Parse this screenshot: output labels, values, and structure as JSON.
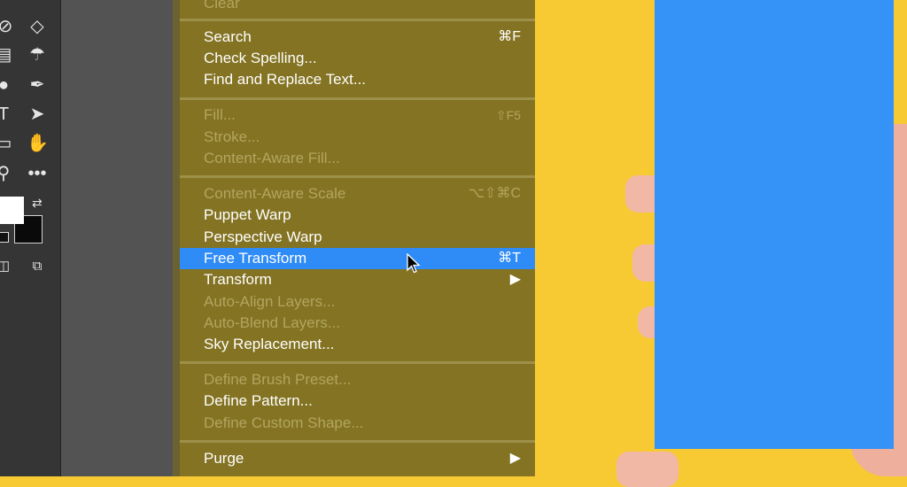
{
  "menu": {
    "top_partial": "Clear",
    "group1": [
      {
        "label": "Search",
        "shortcut": "⌘F",
        "enabled": true
      },
      {
        "label": "Check Spelling...",
        "shortcut": "",
        "enabled": true
      },
      {
        "label": "Find and Replace Text...",
        "shortcut": "",
        "enabled": true
      }
    ],
    "group2": [
      {
        "label": "Fill...",
        "shortcut": "⇧F5",
        "enabled": false
      },
      {
        "label": "Stroke...",
        "shortcut": "",
        "enabled": false
      },
      {
        "label": "Content-Aware Fill...",
        "shortcut": "",
        "enabled": false
      }
    ],
    "group3": [
      {
        "label": "Content-Aware Scale",
        "shortcut": "⌥⇧⌘C",
        "enabled": false
      },
      {
        "label": "Puppet Warp",
        "shortcut": "",
        "enabled": true
      },
      {
        "label": "Perspective Warp",
        "shortcut": "",
        "enabled": true
      },
      {
        "label": "Free Transform",
        "shortcut": "⌘T",
        "enabled": true,
        "highlighted": true
      },
      {
        "label": "Transform",
        "shortcut": "▶",
        "enabled": true
      },
      {
        "label": "Auto-Align Layers...",
        "shortcut": "",
        "enabled": false
      },
      {
        "label": "Auto-Blend Layers...",
        "shortcut": "",
        "enabled": false
      },
      {
        "label": "Sky Replacement...",
        "shortcut": "",
        "enabled": true
      }
    ],
    "group4": [
      {
        "label": "Define Brush Preset...",
        "shortcut": "",
        "enabled": false
      },
      {
        "label": "Define Pattern...",
        "shortcut": "",
        "enabled": true
      },
      {
        "label": "Define Custom Shape...",
        "shortcut": "",
        "enabled": false
      }
    ],
    "group5": [
      {
        "label": "Purge",
        "shortcut": "▶",
        "enabled": true
      }
    ]
  },
  "toolbar": {
    "icons": [
      "brush-icon",
      "eraser-icon",
      "gradient-icon",
      "smudge-icon",
      "dodge-icon",
      "pen-icon",
      "type-icon",
      "selection-arrow-icon",
      "rectangle-icon",
      "hand-icon",
      "zoom-icon",
      "more-icon",
      "swap-colors-icon",
      "quick-mask-icon",
      "screen-mode-icon"
    ]
  },
  "colors": {
    "menu_bg": "#837322",
    "highlight": "#2f8cf6",
    "background": "#f7c933",
    "card": "#3592f6"
  }
}
